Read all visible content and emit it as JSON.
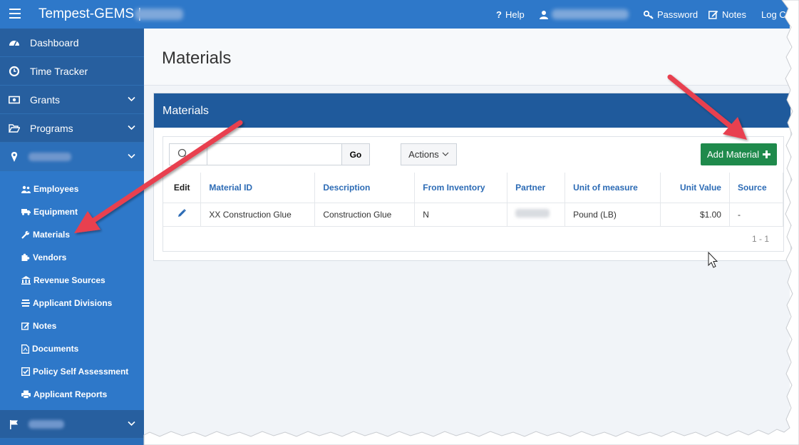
{
  "topbar": {
    "app_title": "Tempest-GEMS |",
    "help": "Help",
    "password": "Password",
    "notes": "Notes",
    "logout": "Log C"
  },
  "sidebar": {
    "main_items": [
      {
        "label": "Dashboard",
        "icon": "dashboard-icon"
      },
      {
        "label": "Time Tracker",
        "icon": "clock-icon"
      },
      {
        "label": "Grants",
        "icon": "money-icon"
      },
      {
        "label": "Programs",
        "icon": "folder-open-icon"
      }
    ],
    "sub_items": [
      {
        "label": "Employees",
        "icon": "users-icon"
      },
      {
        "label": "Equipment",
        "icon": "truck-icon"
      },
      {
        "label": "Materials",
        "icon": "wrench-icon"
      },
      {
        "label": "Vendors",
        "icon": "puzzle-icon"
      },
      {
        "label": "Revenue Sources",
        "icon": "bank-icon"
      },
      {
        "label": "Applicant Divisions",
        "icon": "divide-icon"
      },
      {
        "label": "Notes",
        "icon": "edit-icon"
      },
      {
        "label": "Documents",
        "icon": "file-pdf-icon"
      },
      {
        "label": "Policy Self Assessment",
        "icon": "check-square-icon"
      },
      {
        "label": "Applicant Reports",
        "icon": "print-icon"
      }
    ]
  },
  "page": {
    "title": "Materials",
    "region_title": "Materials"
  },
  "grid": {
    "search_placeholder": "",
    "go_label": "Go",
    "actions_label": "Actions",
    "add_label": "Add Material",
    "columns": [
      "Edit",
      "Material ID",
      "Description",
      "From Inventory",
      "Partner",
      "Unit of measure",
      "Unit Value",
      "Source"
    ],
    "rows": [
      {
        "material_id": "XX Construction Glue",
        "description": "Construction Glue",
        "from_inventory": "N",
        "unit": "Pound (LB)",
        "unit_value": "$1.00",
        "source": "-"
      }
    ],
    "pagination": "1 - 1"
  },
  "colors": {
    "topbar": "#2e78c9",
    "sidebar": "#2a6db8",
    "region_header": "#1f5a9c",
    "add_button": "#1f8a4c",
    "link": "#2c6bb5",
    "annotation_arrow": "#e8414f"
  }
}
